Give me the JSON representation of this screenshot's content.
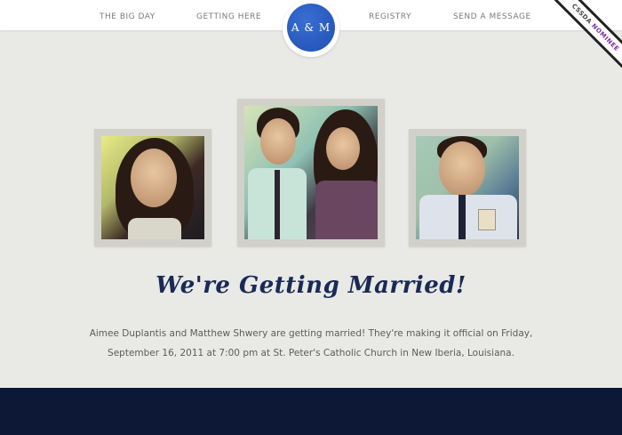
{
  "nav": {
    "left": [
      {
        "label": "THE BIG DAY"
      },
      {
        "label": "GETTING HERE"
      }
    ],
    "right": [
      {
        "label": "REGISTRY"
      },
      {
        "label": "SEND A MESSAGE"
      }
    ]
  },
  "monogram": "A & M",
  "ribbon": {
    "line1": "CSSDA",
    "line2": "NOMINEE"
  },
  "photos": [
    {
      "icon": "photo-aimee"
    },
    {
      "icon": "photo-couple"
    },
    {
      "icon": "photo-matthew"
    }
  ],
  "headline": "We're Getting Married!",
  "intro": "Aimee Duplantis and Matthew Shwery are getting married! They're making it official on Friday, September 16, 2011 at 7:00 pm at St. Peter's Catholic Church in New Iberia, Louisiana.",
  "colors": {
    "background": "#e9e9e5",
    "navy": "#1a2a57",
    "footer": "#0c1836",
    "accent": "#1f4fb1"
  }
}
